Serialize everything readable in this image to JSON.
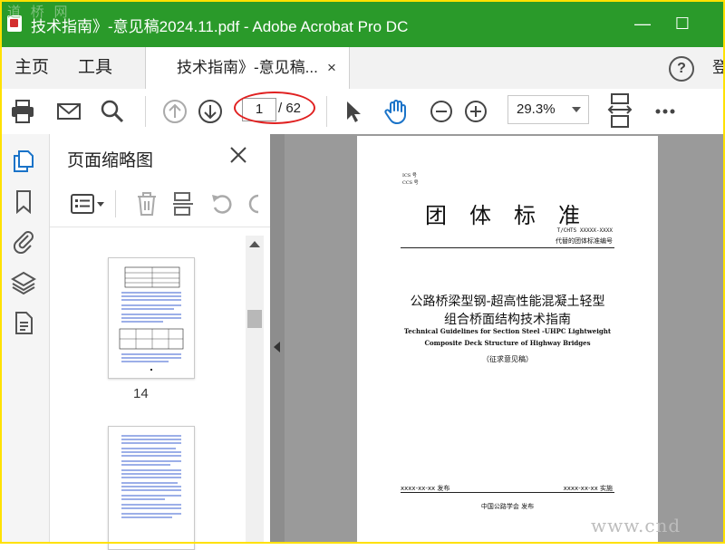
{
  "window": {
    "title": "技术指南》-意见稿2024.11.pdf - Adobe Acrobat Pro DC",
    "minimize_glyph": "—",
    "maximize_glyph": "☐",
    "watermark_top": "道 桥 网"
  },
  "menubar": {
    "home": "主页",
    "tools": "工具",
    "doc_tab_label": "技术指南》-意见稿...",
    "doc_tab_close": "×",
    "help_glyph": "?",
    "login_partial": "登"
  },
  "toolbar": {
    "page_current": "1",
    "page_total": "/ 62",
    "zoom": "29.3%"
  },
  "left_rail": {
    "icons": [
      "pages-icon",
      "bookmark-icon",
      "attachment-icon",
      "layers-icon",
      "document-icon"
    ]
  },
  "thumbnail_panel": {
    "title": "页面缩略图",
    "thumb_page_label": "14"
  },
  "document_page": {
    "code_line_1": "ICS 号",
    "code_line_2": "CCS 号",
    "standard_heading": "团体标准",
    "standard_number": "T/CHTS XXXXX-XXXX",
    "standard_replaces": "代替的团体标准编号",
    "title_cn_line1": "公路桥梁型钢-超高性能混凝土轻型",
    "title_cn_line2": "组合桥面结构技术指南",
    "title_en_line1": "Technical Guidelines for Section Steel -UHPC Lightweight",
    "title_en_line2": "Composite Deck Structure of Highway Bridges",
    "draft_note": "（征求意见稿）",
    "publish_date": "xxxx-xx-xx 发布",
    "implement_date": "xxxx-xx-xx 实施",
    "issuer": "中国公路学会  发布"
  },
  "watermark_bottom": "www.cnd",
  "colors": {
    "title_bar": "#2a9a2a",
    "rail_icon": "#1a73c8",
    "page_marker": "#e02020",
    "border_frame": "#ffe100"
  }
}
